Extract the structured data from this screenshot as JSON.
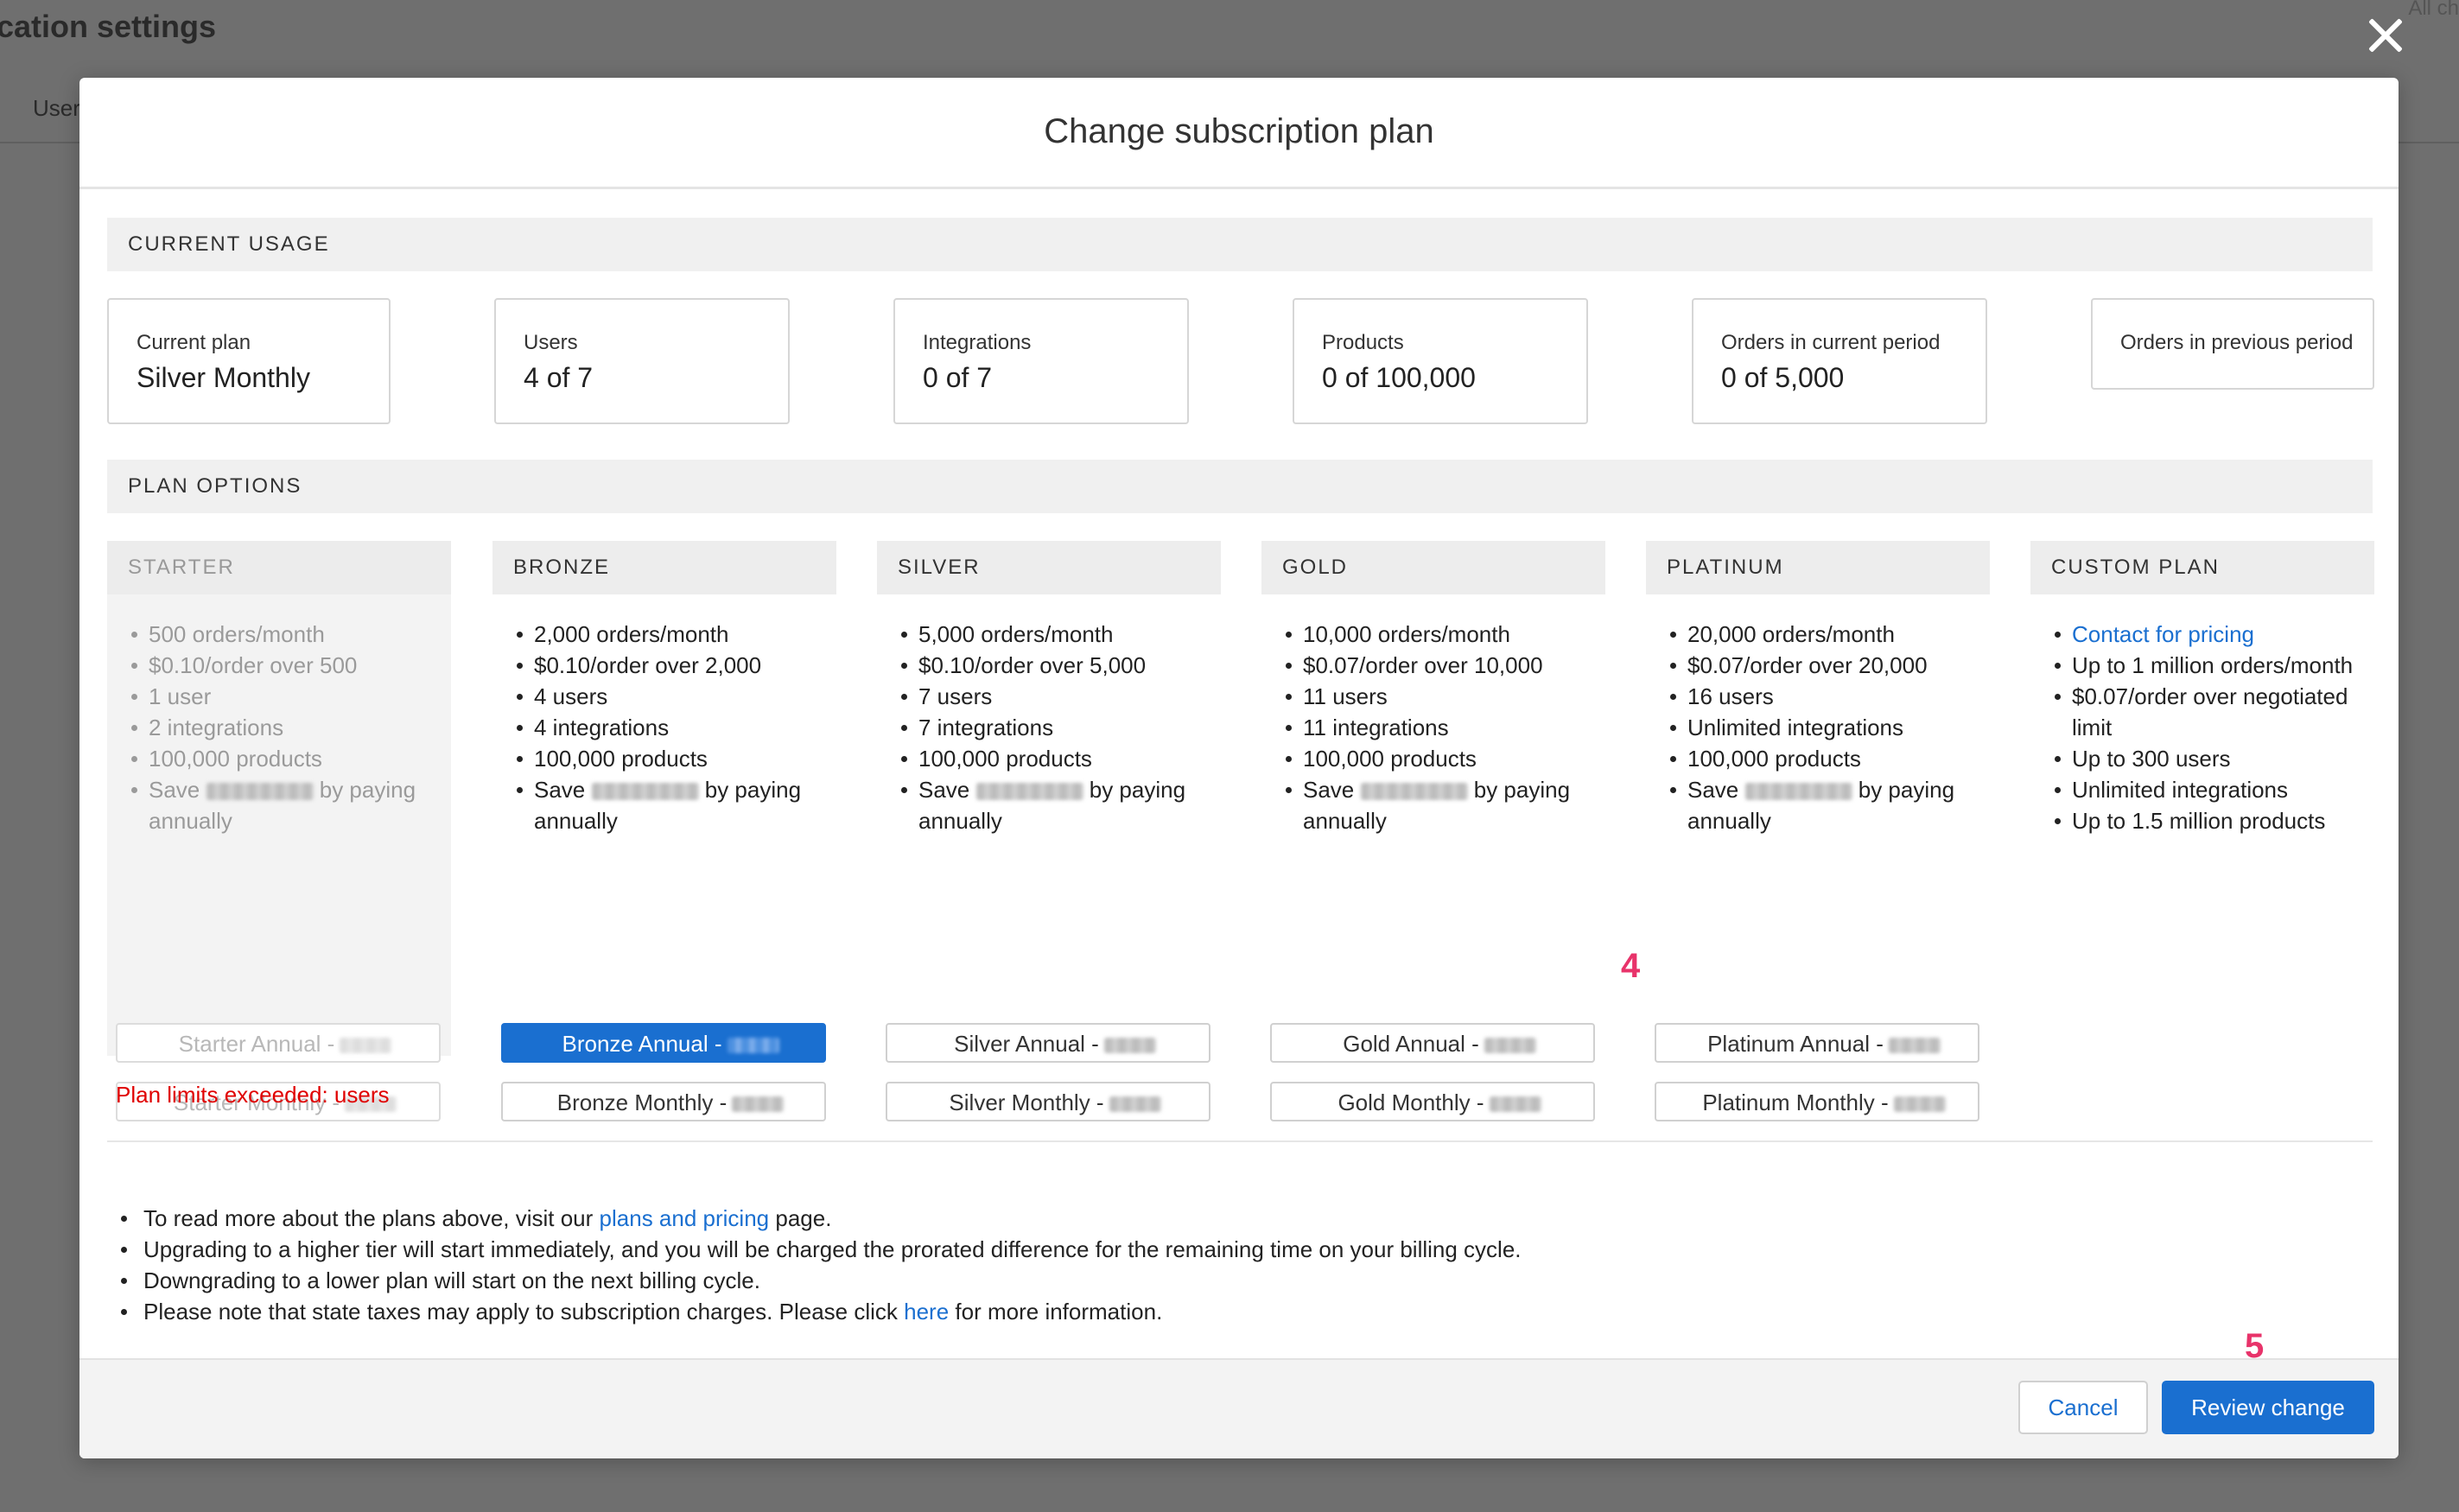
{
  "backdrop": {
    "title": "cation settings",
    "tab": "User",
    "corner_text": "All ch"
  },
  "modal": {
    "title": "Change subscription plan"
  },
  "current_usage": {
    "heading": "CURRENT USAGE",
    "cards": [
      {
        "label": "Current plan",
        "value": "Silver Monthly"
      },
      {
        "label": "Users",
        "value": "4 of 7"
      },
      {
        "label": "Integrations",
        "value": "0 of 7"
      },
      {
        "label": "Products",
        "value": "0 of 100,000"
      },
      {
        "label": "Orders in current period",
        "value": "0 of 5,000"
      },
      {
        "label": "Orders in previous period",
        "value": ""
      }
    ]
  },
  "plan_options": {
    "heading": "PLAN OPTIONS",
    "plans": [
      {
        "name": "STARTER",
        "features": [
          "500 orders/month",
          "$0.10/order over 500",
          "1 user",
          "2 integrations",
          "100,000 products"
        ],
        "save_prefix": "Save",
        "save_suffix": "by paying annually",
        "annual_label": "Starter Annual -",
        "monthly_label": "Starter Monthly -"
      },
      {
        "name": "BRONZE",
        "features": [
          "2,000 orders/month",
          "$0.10/order over 2,000",
          "4 users",
          "4 integrations",
          "100,000 products"
        ],
        "save_prefix": "Save",
        "save_suffix": "by paying annually",
        "annual_label": "Bronze Annual -",
        "monthly_label": "Bronze Monthly -"
      },
      {
        "name": "SILVER",
        "features": [
          "5,000 orders/month",
          "$0.10/order over 5,000",
          "7 users",
          "7 integrations",
          "100,000 products"
        ],
        "save_prefix": "Save",
        "save_suffix": "by paying annually",
        "annual_label": "Silver Annual -",
        "monthly_label": "Silver Monthly -"
      },
      {
        "name": "GOLD",
        "features": [
          "10,000 orders/month",
          "$0.07/order over 10,000",
          "11 users",
          "11 integrations",
          "100,000 products"
        ],
        "save_prefix": "Save",
        "save_suffix": "by paying annually",
        "annual_label": "Gold Annual -",
        "monthly_label": "Gold Monthly -"
      },
      {
        "name": "PLATINUM",
        "features": [
          "20,000 orders/month",
          "$0.07/order over 20,000",
          "16 users",
          "Unlimited integrations",
          "100,000 products"
        ],
        "save_prefix": "Save",
        "save_suffix": "by paying annually",
        "annual_label": "Platinum Annual -",
        "monthly_label": "Platinum Monthly -"
      },
      {
        "name": "CUSTOM PLAN",
        "contact_link": "Contact for pricing",
        "features": [
          "Up to 1 million orders/month",
          "$0.07/order over negotiated limit",
          "Up to 300 users",
          "Unlimited integrations",
          "Up to 1.5 million products"
        ]
      }
    ],
    "warning": "Plan limits exceeded: users"
  },
  "notes": {
    "n1_prefix": "To read more about the plans above, visit our",
    "n1_link": "plans and pricing",
    "n1_suffix": "page.",
    "n2": "Upgrading to a higher tier will start immediately, and you will be charged the prorated difference for the remaining time on your billing cycle.",
    "n3": "Downgrading to a lower plan will start on the next billing cycle.",
    "n4_prefix": "Please note that state taxes may apply to subscription charges. Please click",
    "n4_link": "here",
    "n4_suffix": "for more information."
  },
  "footer": {
    "cancel_label": "Cancel",
    "review_label": "Review change"
  },
  "annotations": {
    "marker_4": "4",
    "marker_5": "5"
  },
  "colors": {
    "accent": "#1a6fd0",
    "warning": "#e00000",
    "marker": "#e8336a"
  }
}
